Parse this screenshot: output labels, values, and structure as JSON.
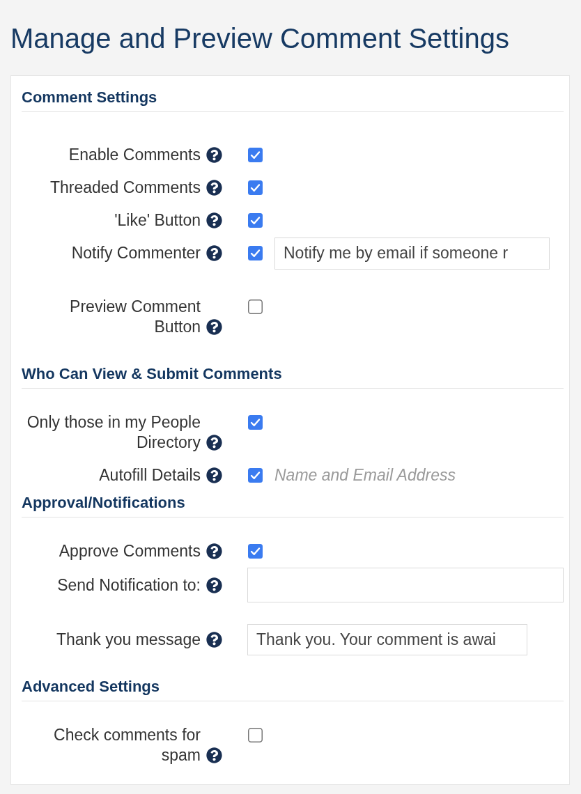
{
  "title": "Manage and Preview Comment Settings",
  "sections": [
    {
      "heading": "Comment Settings",
      "rows": [
        {
          "kind": "checkbox",
          "label": "Enable Comments",
          "checked": true
        },
        {
          "kind": "checkbox",
          "label": "Threaded Comments",
          "checked": true
        },
        {
          "kind": "checkbox",
          "label": "'Like' Button",
          "checked": true
        },
        {
          "kind": "checkboxinput",
          "label": "Notify Commenter",
          "checked": true,
          "value": "Notify me by email if someone r"
        },
        {
          "kind": "checkbox",
          "label": "Preview Comment Button",
          "checked": false
        }
      ]
    },
    {
      "heading": "Who Can View & Submit Comments",
      "rows": [
        {
          "kind": "checkbox",
          "label": "Only those in my People Directory",
          "checked": true
        },
        {
          "kind": "checkbox",
          "label": "Autofill Details",
          "checked": true,
          "note": "Name and Email Address"
        }
      ]
    },
    {
      "heading": "Approval/Notifications",
      "rows": [
        {
          "kind": "checkbox",
          "label": "Approve Comments",
          "checked": true
        },
        {
          "kind": "wideinput",
          "label": "Send Notification to:"
        },
        {
          "kind": "input",
          "label": "Thank you message",
          "value": "Thank you. Your comment is awai"
        }
      ]
    },
    {
      "heading": "Advanced Settings",
      "rows": [
        {
          "kind": "checkbox",
          "label": "Check comments for spam",
          "checked": false
        }
      ]
    }
  ]
}
